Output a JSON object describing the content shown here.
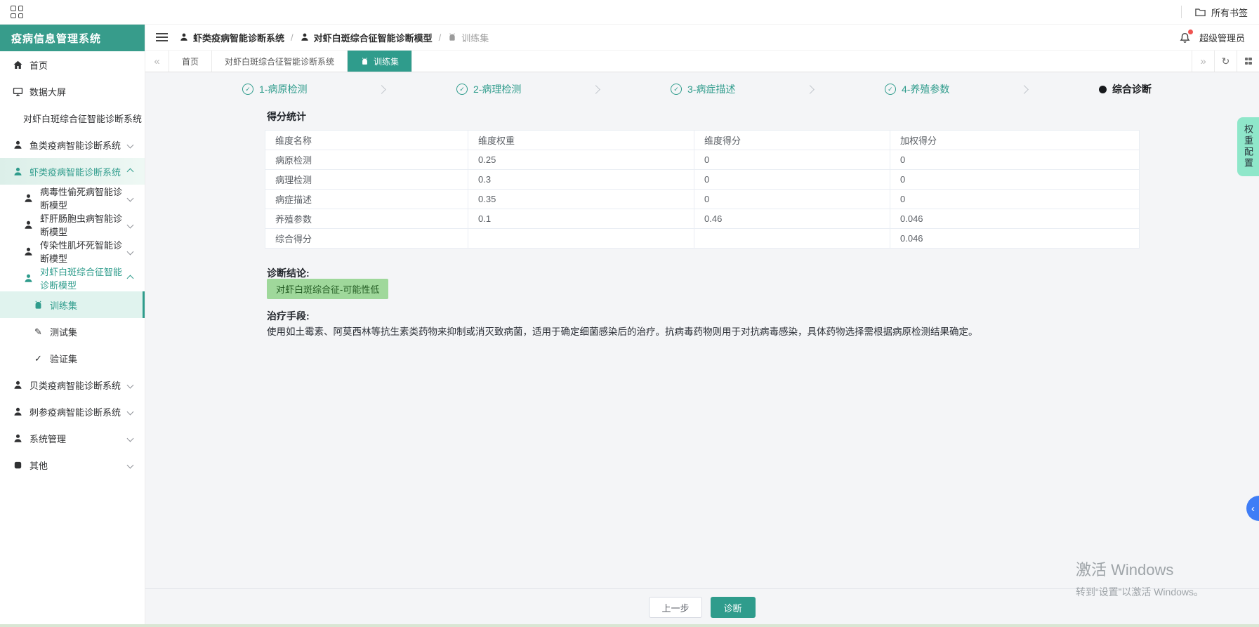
{
  "browser_bar": {
    "bookmarks_label": "所有书签"
  },
  "sidebar": {
    "title": "疫病信息管理系统",
    "items": [
      {
        "label": "首页",
        "icon": "home"
      },
      {
        "label": "数据大屏",
        "icon": "monitor"
      },
      {
        "label": "对虾白斑综合征智能诊断系统",
        "icon": null
      },
      {
        "label": "鱼类疫病智能诊断系统",
        "icon": "user",
        "chevron": "down"
      },
      {
        "label": "虾类疫病智能诊断系统",
        "icon": "user",
        "chevron": "up",
        "highlighted": true
      },
      {
        "label": "病毒性偷死病智能诊断模型",
        "icon": "user",
        "chevron": "down"
      },
      {
        "label": "虾肝肠胞虫病智能诊断模型",
        "icon": "user",
        "chevron": "down"
      },
      {
        "label": "传染性肌坏死智能诊断模型",
        "icon": "user",
        "chevron": "down"
      },
      {
        "label": "对虾白斑综合征智能诊断模型",
        "icon": "user",
        "chevron": "up",
        "highlighted": true
      },
      {
        "label": "训练集",
        "icon": "robot",
        "active": true
      },
      {
        "label": "测试集",
        "icon": "pencil"
      },
      {
        "label": "验证集",
        "icon": "check"
      },
      {
        "label": "贝类疫病智能诊断系统",
        "icon": "user",
        "chevron": "down"
      },
      {
        "label": "刺参疫病智能诊断系统",
        "icon": "user",
        "chevron": "down"
      },
      {
        "label": "系统管理",
        "icon": "user",
        "chevron": "down"
      },
      {
        "label": "其他",
        "icon": "misc",
        "chevron": "down"
      }
    ]
  },
  "header": {
    "breadcrumb": [
      {
        "label": "虾类疫病智能诊断系统"
      },
      {
        "label": "对虾白斑综合征智能诊断模型"
      },
      {
        "label": "训练集"
      }
    ],
    "breadcrumb_sep": "/",
    "user": "超级管理员"
  },
  "tabs": [
    {
      "label": "首页"
    },
    {
      "label": "对虾白斑综合征智能诊断系统"
    },
    {
      "label": "训练集",
      "active": true
    }
  ],
  "steps": [
    {
      "label": "1-病原检测",
      "state": "done"
    },
    {
      "label": "2-病理检测",
      "state": "done"
    },
    {
      "label": "3-病症描述",
      "state": "done"
    },
    {
      "label": "4-养殖参数",
      "state": "done"
    },
    {
      "label": "综合诊断",
      "state": "current"
    }
  ],
  "score_section": {
    "title": "得分统计",
    "table": {
      "headers": [
        "维度名称",
        "维度权重",
        "维度得分",
        "加权得分"
      ],
      "rows": [
        [
          "病原检测",
          "0.25",
          "0",
          "0"
        ],
        [
          "病理检测",
          "0.3",
          "0",
          "0"
        ],
        [
          "病症描述",
          "0.35",
          "0",
          "0"
        ],
        [
          "养殖参数",
          "0.1",
          "0.46",
          "0.046"
        ],
        [
          "综合得分",
          "",
          "",
          "0.046"
        ]
      ]
    }
  },
  "diagnosis": {
    "label": "诊断结论:",
    "result": "对虾白斑综合征-可能性低"
  },
  "treatment": {
    "label": "治疗手段:",
    "text": "使用如土霉素、阿莫西林等抗生素类药物来抑制或消灭致病菌，适用于确定细菌感染后的治疗。抗病毒药物则用于对抗病毒感染，具体药物选择需根据病原检测结果确定。"
  },
  "footer": {
    "prev_label": "上一步",
    "diagnose_label": "诊断"
  },
  "right_rail": {
    "weight_config": "权重配置"
  },
  "watermark": {
    "line1": "激活 Windows",
    "line2": "转到“设置”以激活 Windows。"
  },
  "colors": {
    "primary_teal": "#2f9c8c",
    "badge_green_bg": "#9fd89b",
    "fab_blue": "#3f7df6",
    "notify_red": "#ef5350"
  },
  "icons": {
    "check": "✓",
    "pencil": "✎",
    "collapse_left": "«",
    "forward": "»",
    "refresh": "↻",
    "chevron_left": "‹"
  }
}
